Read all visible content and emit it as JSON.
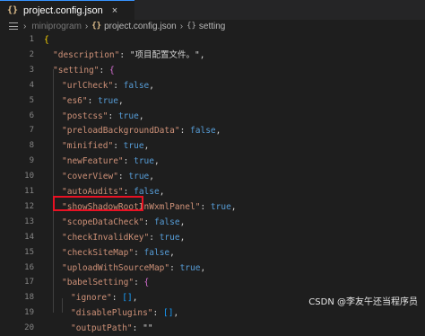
{
  "tab": {
    "icon": "{}",
    "label": "project.config.json",
    "close": "×"
  },
  "breadcrumb": {
    "path": "miniprogram",
    "file": "project.config.json",
    "file_icon": "{}",
    "object_icon": "{}",
    "object": "setting"
  },
  "lines": [
    {
      "n": "1",
      "t": "{"
    },
    {
      "n": "2",
      "t": "\"description\": \"项目配置文件。\","
    },
    {
      "n": "3",
      "t": "\"setting\": {"
    },
    {
      "n": "4",
      "t": "\"urlCheck\": false,"
    },
    {
      "n": "5",
      "t": "\"es6\": true,"
    },
    {
      "n": "6",
      "t": "\"postcss\": true,"
    },
    {
      "n": "7",
      "t": "\"preloadBackgroundData\": false,"
    },
    {
      "n": "8",
      "t": "\"minified\": true,"
    },
    {
      "n": "9",
      "t": "\"newFeature\": true,"
    },
    {
      "n": "10",
      "t": "\"coverView\": true,"
    },
    {
      "n": "11",
      "t": "\"autoAudits\": false,"
    },
    {
      "n": "12",
      "t": "\"showShadowRootInWxmlPanel\": true,"
    },
    {
      "n": "13",
      "t": "\"scopeDataCheck\": false,"
    },
    {
      "n": "14",
      "t": "\"checkInvalidKey\": true,"
    },
    {
      "n": "15",
      "t": "\"checkSiteMap\": false,"
    },
    {
      "n": "16",
      "t": "\"uploadWithSourceMap\": true,"
    },
    {
      "n": "17",
      "t": "\"babelSetting\": {"
    },
    {
      "n": "18",
      "t": "\"ignore\": [],"
    },
    {
      "n": "19",
      "t": "\"disablePlugins\": [],"
    },
    {
      "n": "20",
      "t": "\"outputPath\": \"\""
    }
  ],
  "watermark": "CSDN @李友午还当程序员",
  "colors": {
    "highlight": "#e81123",
    "key": "#ce9178",
    "boolean": "#569cd6"
  }
}
